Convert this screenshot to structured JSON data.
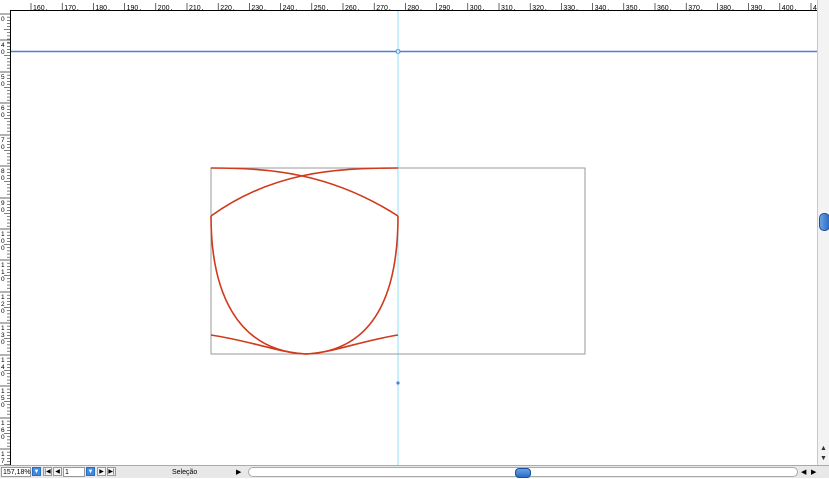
{
  "ruler_top": {
    "labels": [
      "160",
      "170",
      "180",
      "190",
      "200",
      "210",
      "220",
      "230",
      "240",
      "250",
      "260",
      "270",
      "280",
      "290",
      "300",
      "310",
      "320",
      "330",
      "340",
      "350",
      "360",
      "370",
      "380",
      "390",
      "400",
      "41"
    ]
  },
  "ruler_left": {
    "labels": [
      "0",
      "4 0",
      "5 0",
      "6 0",
      "7 0",
      "8 0",
      "9 0",
      "1 0 0",
      "1 1 0",
      "1 2 0",
      "1 3 0",
      "1 4 0",
      "1 5 0",
      "1 6 0",
      "1 7 0"
    ]
  },
  "canvas": {
    "guide_color": "#4d7fd6",
    "vertical_guide_color": "#8fe0f5",
    "frame_color": "#9a9a9a",
    "path_color": "#d0391b"
  },
  "status": {
    "zoom": "157,18%",
    "page": "1",
    "tool_label": "Seleção",
    "first_page_icon": "first-page-icon",
    "prev_page_icon": "prev-page-icon",
    "next_page_icon": "next-page-icon",
    "last_page_icon": "last-page-icon"
  }
}
